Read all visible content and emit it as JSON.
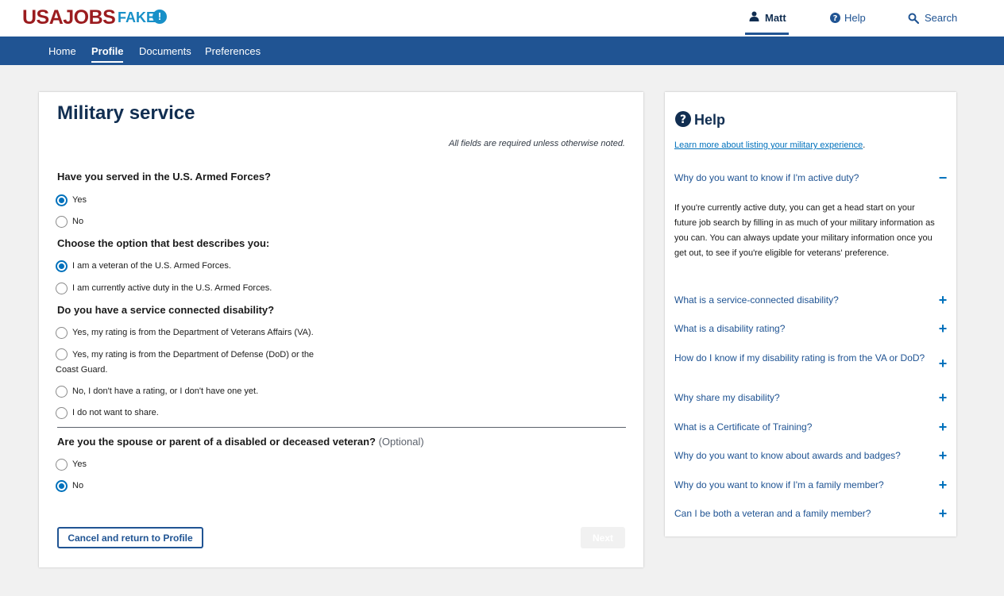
{
  "brand": {
    "logo": "USAJOBS",
    "tag": "FAKE",
    "badge": "!"
  },
  "topnav": {
    "user": "Matt",
    "help": "Help",
    "search": "Search"
  },
  "subnav": [
    "Home",
    "Profile",
    "Documents",
    "Preferences"
  ],
  "subnav_active": "Profile",
  "page": {
    "title": "Military service",
    "required_note": "All fields are required unless otherwise noted."
  },
  "questions": [
    {
      "label": "Have you served in the U.S. Armed Forces?",
      "options": [
        {
          "label": "Yes",
          "checked": true
        },
        {
          "label": "No",
          "checked": false
        }
      ]
    },
    {
      "label": "Choose the option that best describes you:",
      "options": [
        {
          "label": "I am a veteran of the U.S. Armed Forces.",
          "checked": true
        },
        {
          "label": "I am currently active duty in the U.S. Armed Forces.",
          "checked": false
        }
      ]
    },
    {
      "label": "Do you have a service connected disability?",
      "options": [
        {
          "label": "Yes, my rating is from the Department of Veterans Affairs (VA).",
          "checked": false
        },
        {
          "label": "Yes, my rating is from the Department of Defense (DoD) or the Coast Guard.",
          "checked": false
        },
        {
          "label": "No, I don't have a rating, or I don't have one yet.",
          "checked": false
        },
        {
          "label": "I do not want to share.",
          "checked": false
        }
      ]
    },
    {
      "label": "Are you the spouse or parent of a disabled or deceased veteran?",
      "optional_text": "(Optional)",
      "options": [
        {
          "label": "Yes",
          "checked": false
        },
        {
          "label": "No",
          "checked": true
        }
      ]
    }
  ],
  "buttons": {
    "cancel": "Cancel and return to Profile",
    "next": "Next"
  },
  "help": {
    "title": "Help",
    "link": "Learn more about listing your military experience",
    "link_suffix": ".",
    "expanded_question": "Why do you want to know if I'm active duty?",
    "expanded_toggle": "−",
    "expanded_answer": "If you're currently active duty, you can get a head start on your future job search by filling in as much of your military information as you can. You can always update your military information once you get out, to see if you're eligible for veterans' preference.",
    "collapsed_toggle": "+",
    "collapsed_questions": [
      "What is a service-connected disability?",
      "What is a disability rating?",
      "How do I know if my disability rating is from the VA or DoD?",
      "Why share my disability?",
      "What is a Certificate of Training?",
      "Why do you want to know about awards and badges?",
      "Why do you want to know if I'm a family member?",
      "Can I be both a veteran and a family member?"
    ]
  },
  "colors": {
    "brand_red": "#9b1c1f",
    "navy": "#205493",
    "link_blue": "#0071bc",
    "fake_blue": "#1890c8"
  }
}
